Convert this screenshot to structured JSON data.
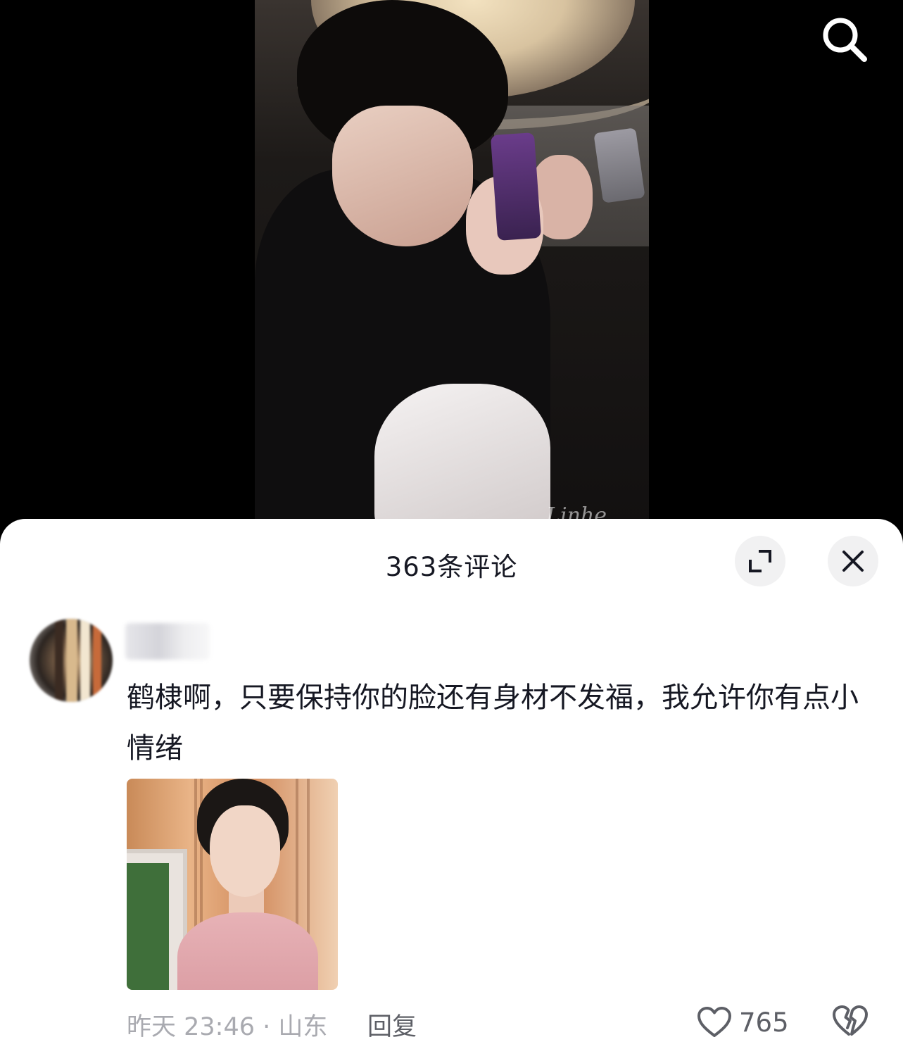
{
  "sheet": {
    "title": "363条评论"
  },
  "comment": {
    "text": "鹤棣啊，只要保持你的脸还有身材不发福，我允许你有点小情绪",
    "time_location": "昨天 23:46 · 山东",
    "reply_label": "回复",
    "like_count": "765"
  },
  "video": {
    "watermark": "Linhe"
  },
  "colors": {
    "sheet_bg": "#ffffff",
    "text_primary": "#161823",
    "text_secondary": "#a9aab0",
    "icon_gray": "#5d5f66",
    "button_bg": "#f1f1f2"
  },
  "icons": {
    "search": "search-icon",
    "expand": "expand-icon",
    "close": "close-icon",
    "like": "heart-icon",
    "dislike": "broken-heart-icon"
  }
}
